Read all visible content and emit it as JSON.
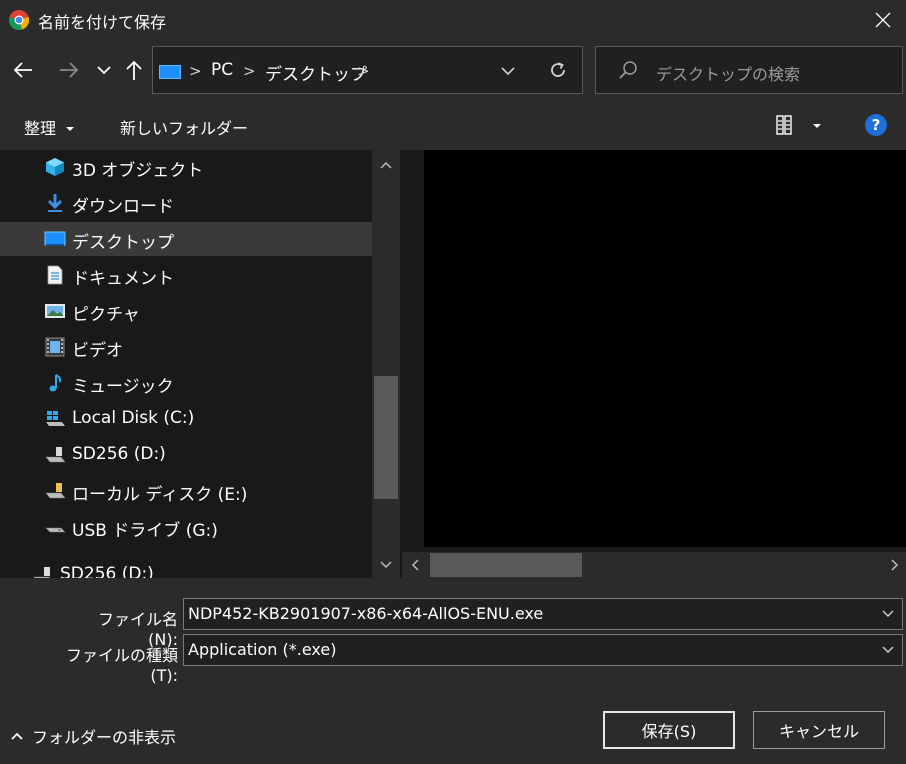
{
  "window": {
    "title": "名前を付けて保存",
    "app_icon": "chrome-icon"
  },
  "nav": {
    "back_icon": "arrow-left-icon",
    "forward_icon": "arrow-right-icon",
    "recent_icon": "chevron-down-icon",
    "up_icon": "arrow-up-icon",
    "breadcrumb": [
      "PC",
      "デスクトップ"
    ],
    "refresh_icon": "refresh-icon",
    "search_placeholder": "デスクトップの検索"
  },
  "toolbar": {
    "organize_label": "整理",
    "new_folder_label": "新しいフォルダー",
    "view_icon": "view-options-icon",
    "help_label": "?"
  },
  "sidebar": {
    "items": [
      {
        "label": "3D オブジェクト",
        "icon": "3d-objects-icon",
        "selected": false
      },
      {
        "label": "ダウンロード",
        "icon": "download-icon",
        "selected": false
      },
      {
        "label": "デスクトップ",
        "icon": "desktop-icon",
        "selected": true
      },
      {
        "label": "ドキュメント",
        "icon": "documents-icon",
        "selected": false
      },
      {
        "label": "ピクチャ",
        "icon": "pictures-icon",
        "selected": false
      },
      {
        "label": "ビデオ",
        "icon": "videos-icon",
        "selected": false
      },
      {
        "label": "ミュージック",
        "icon": "music-icon",
        "selected": false
      },
      {
        "label": "Local Disk (C:)",
        "icon": "windows-drive-icon",
        "selected": false
      },
      {
        "label": "SD256 (D:)",
        "icon": "drive-icon",
        "selected": false
      },
      {
        "label": "ローカル ディスク (E:)",
        "icon": "drive-icon",
        "selected": false
      },
      {
        "label": "USB ドライブ (G:)",
        "icon": "usb-drive-icon",
        "selected": false
      },
      {
        "label": "SD256 (D:)",
        "icon": "drive-icon",
        "selected": false
      }
    ]
  },
  "form": {
    "filename_label": "ファイル名(N):",
    "filename_value": "NDP452-KB2901907-x86-x64-AllOS-ENU.exe",
    "filetype_label": "ファイルの種類(T):",
    "filetype_value": "Application (*.exe)"
  },
  "footer": {
    "hide_folders_label": "フォルダーの非表示",
    "save_label": "保存(S)",
    "cancel_label": "キャンセル"
  },
  "colors": {
    "accent": "#1e90ff",
    "background": "#202020",
    "chrome": "#2b2b2b",
    "selected": "#3a3a3a"
  }
}
